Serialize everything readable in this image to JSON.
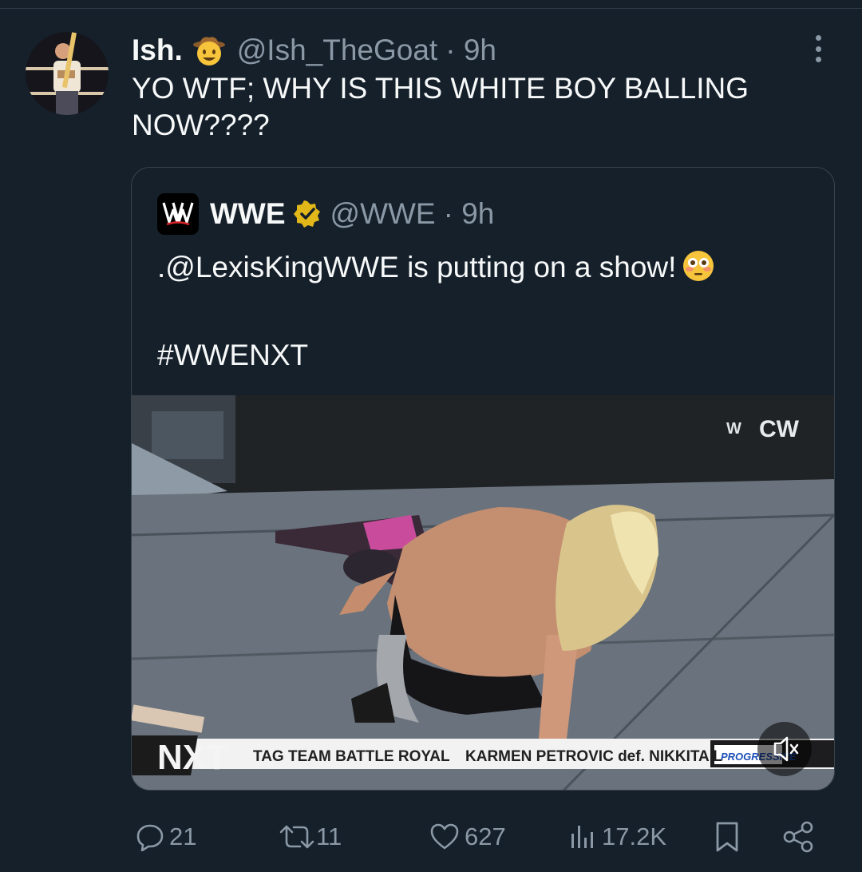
{
  "tweet": {
    "author_name": "Ish.",
    "author_emoji": "cowboy-hat-face",
    "author_handle": "@Ish_TheGoat",
    "time": "· 9h",
    "text": "YO WTF; WHY IS THIS WHITE BOY BALLING NOW????"
  },
  "quote": {
    "author_name": "WWE",
    "author_handle": "@WWE",
    "time": "· 9h",
    "text": ".@LexisKingWWE is putting on a show!",
    "text_emoji": "flushed-face",
    "hashtag": "#WWENXT",
    "video": {
      "network_logo": "CW",
      "show_logo": "NXT",
      "ticker_left": "TAG TEAM BATTLE ROYAL",
      "ticker_right": "KARMEN PETROVIC def. NIKKITA L",
      "ticker_badge": "PROGRESSIVE",
      "mute_icon": "speaker-muted-icon"
    }
  },
  "actions": {
    "replies": "21",
    "reposts": "11",
    "likes": "627",
    "views": "17.2K"
  },
  "colors": {
    "background": "#15202b",
    "text": "#f7f9f9",
    "secondary": "#8b98a5",
    "border": "#38444d"
  }
}
